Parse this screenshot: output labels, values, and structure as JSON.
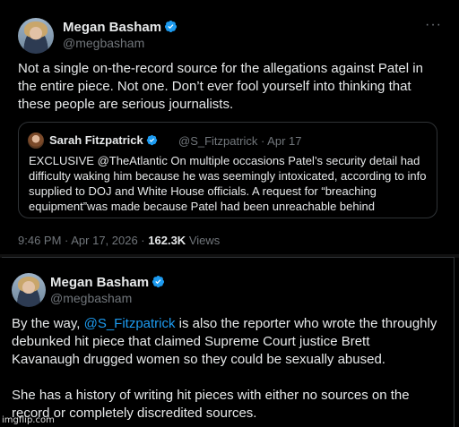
{
  "tweet1": {
    "author_name": "Megan Basham",
    "author_handle": "@megbasham",
    "text": "Not a single on-the-record source for the allegations against Patel in the entire piece. Not one. Don’t ever fool yourself into thinking that these people are serious journalists.",
    "quote": {
      "author_name": "Sarah Fitzpatrick",
      "author_handle": "@S_Fitzpatrick",
      "date": "· Apr 17",
      "text": "EXCLUSIVE @TheAtlantic On multiple occasions Patel’s security detail had difficulty waking him because he was seemingly intoxicated, according to info supplied to DOJ and White House officials. A request for “breaching equipment”was made because Patel had been unreachable behind"
    },
    "timestamp": "9:46 PM · Apr 17, 2026 ·",
    "views_count": "162.3K",
    "views_label": "Views",
    "more_glyph": "···"
  },
  "tweet2": {
    "author_name": "Megan Basham",
    "author_handle": "@megbasham",
    "text_pre": "By the way, ",
    "mention": "@S_Fitzpatrick",
    "text_post": " is also the reporter who wrote the throughly debunked hit piece that claimed Supreme Court justice Brett Kavanaugh drugged women so they could be sexually abused.",
    "text2": "She has a history of writing hit pieces with either no sources on the record or completely discredited sources."
  },
  "watermark": "imgflip.com",
  "colors": {
    "background": "#000000",
    "text": "#e7e9ea",
    "muted": "#71767b",
    "accent": "#1d9bf0",
    "border": "#2f3336"
  },
  "icons": {
    "verified": "verified-badge-icon",
    "more": "more-options-icon"
  }
}
